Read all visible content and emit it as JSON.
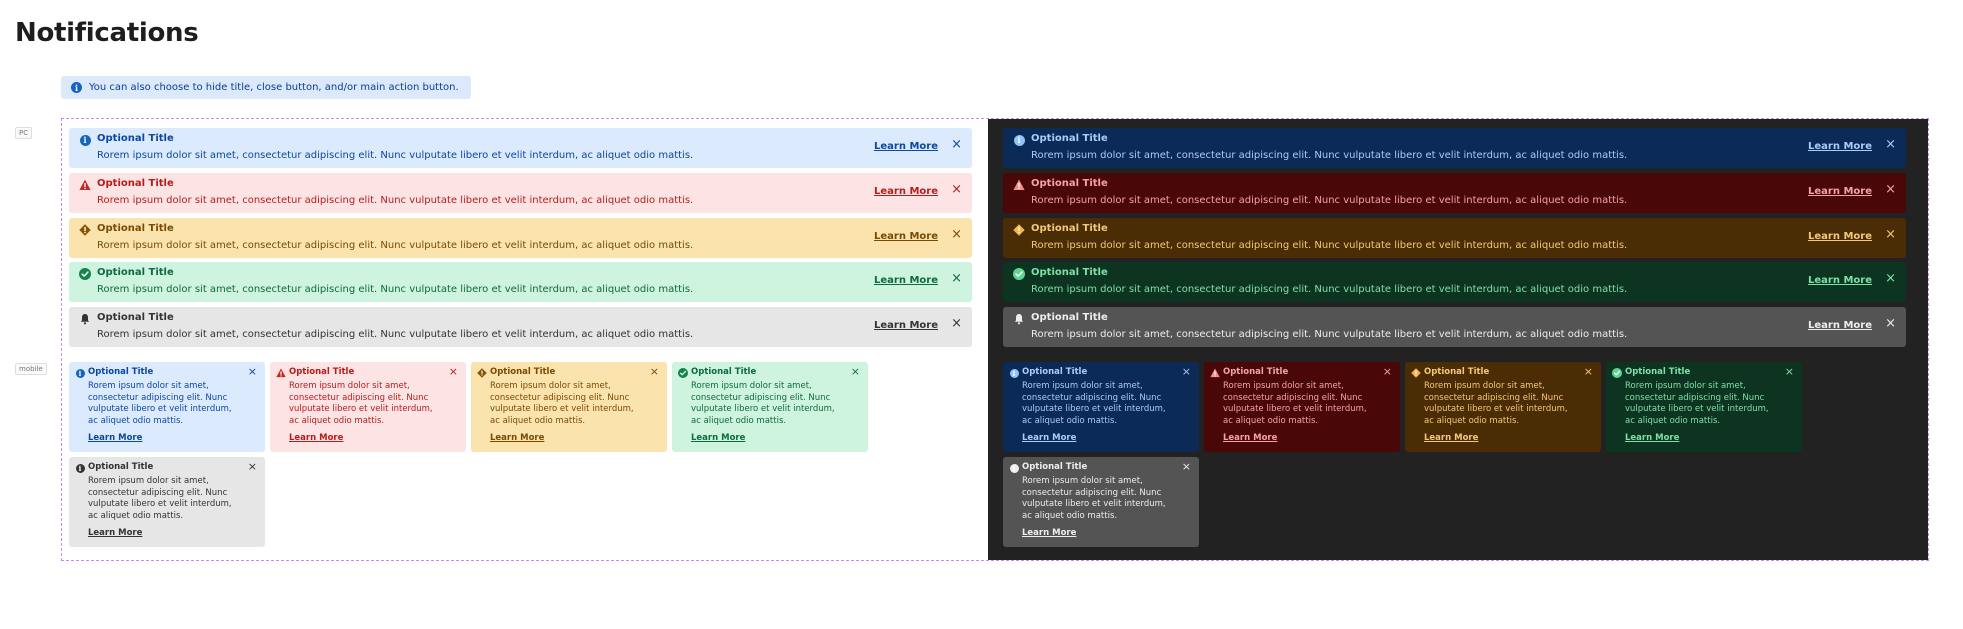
{
  "page_title": "Notifications",
  "hint": {
    "text": "You can also choose to hide title, close button, and/or main action button."
  },
  "labels": {
    "pc": "PC",
    "mobile": "mobile"
  },
  "notification": {
    "title": "Optional Title",
    "message": "Rorem ipsum dolor sit amet, consectetur adipiscing elit. Nunc vulputate libero et velit interdum, ac aliquet odio mattis.",
    "action": "Learn More",
    "close": "×"
  },
  "variants": [
    {
      "kind": "info",
      "icon": "info-icon"
    },
    {
      "kind": "error",
      "icon": "warning-triangle-icon"
    },
    {
      "kind": "warning",
      "icon": "warning-diamond-icon"
    },
    {
      "kind": "success",
      "icon": "check-circle-icon"
    },
    {
      "kind": "neutral",
      "icon": "bell-icon"
    }
  ],
  "themes": {
    "light": {
      "info": {
        "bg": "#dbeafd",
        "fg": "#0d47a1",
        "icon": "#1565c0"
      },
      "error": {
        "bg": "#fde4e4",
        "fg": "#b71c1c",
        "icon": "#c62828"
      },
      "warning": {
        "bg": "#fbe3ae",
        "fg": "#7a4a00",
        "icon": "#8a5200"
      },
      "success": {
        "bg": "#cef3df",
        "fg": "#0d6b3c",
        "icon": "#13854b"
      },
      "neutral": {
        "bg": "#e6e6e6",
        "fg": "#333333",
        "icon": "#333333"
      }
    },
    "dark": {
      "info": {
        "bg": "#0b2a55",
        "fg": "#a9cdf7",
        "icon": "#90c2fb"
      },
      "error": {
        "bg": "#4a0707",
        "fg": "#f4a3a3",
        "icon": "#f58c8c"
      },
      "warning": {
        "bg": "#4a2c05",
        "fg": "#f5c879",
        "icon": "#f3b54a"
      },
      "success": {
        "bg": "#0d3420",
        "fg": "#7fe0a9",
        "icon": "#5ed593"
      },
      "neutral": {
        "bg": "#545454",
        "fg": "#eeeeee",
        "icon": "#eeeeee"
      }
    }
  }
}
